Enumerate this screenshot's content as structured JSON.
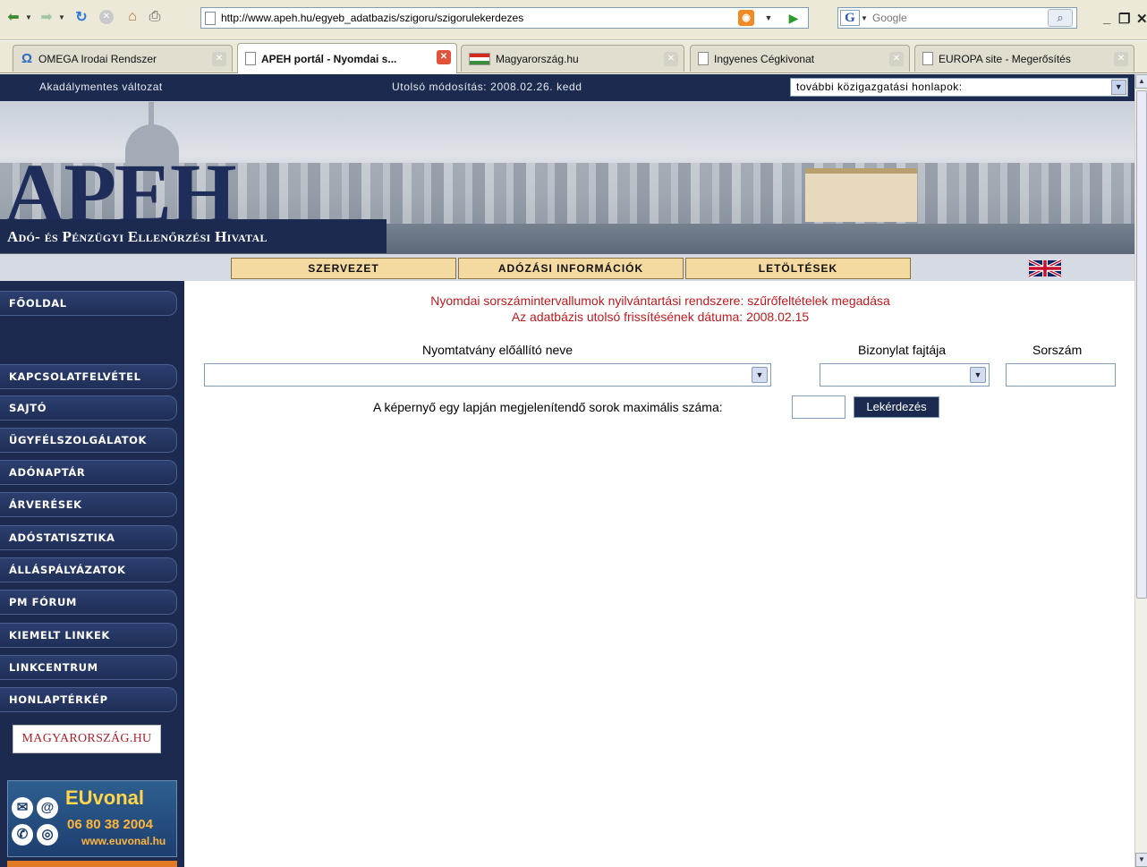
{
  "browser": {
    "url": "http://www.apeh.hu/egyeb_adatbazis/szigoru/szigorulekerdezes",
    "search_placeholder": "Google",
    "tabs": [
      {
        "label": "OMEGA Irodai Rendszer"
      },
      {
        "label": "APEH portál - Nyomdai s..."
      },
      {
        "label": "Magyarország.hu"
      },
      {
        "label": "Ingyenes Cégkivonat"
      },
      {
        "label": "EUROPA site - Megerősítés"
      }
    ]
  },
  "topbar": {
    "accessible_link": "Akadálymentes változat",
    "modified": "Utolsó módosítás: 2008.02.26. kedd",
    "gov_select_value": "további közigazgatási honlapok:"
  },
  "banner": {
    "logo_text": "APEH",
    "subtitle": "Adó- és Pénzügyi Ellenőrzési Hivatal"
  },
  "mainnav": {
    "items": [
      {
        "label": "SZERVEZET"
      },
      {
        "label": "ADÓZÁSI INFORMÁCIÓK"
      },
      {
        "label": "LETÖLTÉSEK"
      }
    ]
  },
  "sidebar": {
    "items": [
      {
        "label": "FŐOLDAL"
      },
      {
        "label": "KAPCSOLATFELVÉTEL"
      },
      {
        "label": "SAJTÓ"
      },
      {
        "label": "ÜGYFÉLSZOLGÁLATOK"
      },
      {
        "label": "ADÓNAPTÁR"
      },
      {
        "label": "ÁRVERÉSEK"
      },
      {
        "label": "ADÓSTATISZTIKA"
      },
      {
        "label": "ÁLLÁSPÁLYÁZATOK"
      },
      {
        "label": "PM FÓRUM"
      },
      {
        "label": "KIEMELT LINKEK"
      },
      {
        "label": "LINKCENTRUM"
      },
      {
        "label": "HONLAPTÉRKÉP"
      }
    ],
    "magyarorszag_link": "MAGYARORSZÁG.HU",
    "euvonal": {
      "title": "EUvonal",
      "phone": "06 80 38 2004",
      "web": "www.euvonal.hu"
    }
  },
  "content": {
    "title_line1": "Nyomdai sorszámintervallumok nyilvántartási rendszere: szűrőfeltételek megadása",
    "title_line2": "Az adatbázis utolsó frissítésének dátuma: 2008.02.15",
    "label_producer": "Nyomtatvány előállító neve",
    "label_doc_type": "Bizonylat fajtája",
    "label_serial": "Sorszám",
    "label_max_rows": "A képernyő egy lapján megjelenítendő sorok maximális száma:",
    "query_button": "Lekérdezés"
  }
}
